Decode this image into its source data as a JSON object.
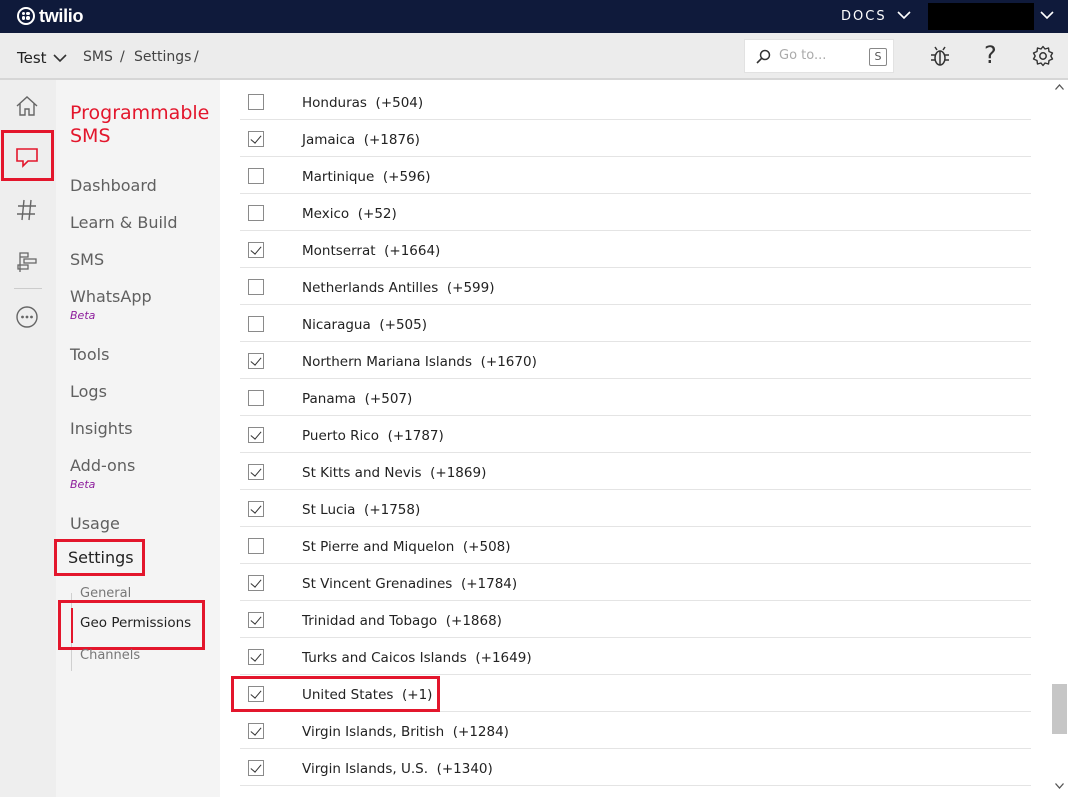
{
  "topbar": {
    "logo_text": "twilio",
    "docs_label": "DOCS"
  },
  "subbar": {
    "project": "Test",
    "breadcrumb": [
      "SMS",
      "/",
      "Settings",
      "/"
    ],
    "search_placeholder": "Go to...",
    "search_shortcut": "S",
    "help_label": "?"
  },
  "rail": {
    "icons": [
      "home-icon",
      "chat-icon",
      "hash-icon",
      "flow-icon",
      "more-icon"
    ]
  },
  "nav": {
    "title": "Programmable SMS",
    "items": [
      {
        "label": "Dashboard"
      },
      {
        "label": "Learn & Build"
      },
      {
        "label": "SMS"
      },
      {
        "label": "WhatsApp",
        "badge": "Beta"
      },
      {
        "label": "Tools"
      },
      {
        "label": "Logs"
      },
      {
        "label": "Insights"
      },
      {
        "label": "Add-ons",
        "badge": "Beta"
      },
      {
        "label": "Usage"
      }
    ],
    "settings_label": "Settings",
    "settings_sub": [
      "General",
      "Geo Permissions",
      "Channels"
    ]
  },
  "countries": [
    {
      "name": "Honduras",
      "code": "(+504)",
      "checked": false
    },
    {
      "name": "Jamaica",
      "code": "(+1876)",
      "checked": true
    },
    {
      "name": "Martinique",
      "code": "(+596)",
      "checked": false
    },
    {
      "name": "Mexico",
      "code": "(+52)",
      "checked": false
    },
    {
      "name": "Montserrat",
      "code": "(+1664)",
      "checked": true
    },
    {
      "name": "Netherlands Antilles",
      "code": "(+599)",
      "checked": false
    },
    {
      "name": "Nicaragua",
      "code": "(+505)",
      "checked": false
    },
    {
      "name": "Northern Mariana Islands",
      "code": "(+1670)",
      "checked": true
    },
    {
      "name": "Panama",
      "code": "(+507)",
      "checked": false
    },
    {
      "name": "Puerto Rico",
      "code": "(+1787)",
      "checked": true
    },
    {
      "name": "St Kitts and Nevis",
      "code": "(+1869)",
      "checked": true
    },
    {
      "name": "St Lucia",
      "code": "(+1758)",
      "checked": true
    },
    {
      "name": "St Pierre and Miquelon",
      "code": "(+508)",
      "checked": false
    },
    {
      "name": "St Vincent Grenadines",
      "code": "(+1784)",
      "checked": true
    },
    {
      "name": "Trinidad and Tobago",
      "code": "(+1868)",
      "checked": true
    },
    {
      "name": "Turks and Caicos Islands",
      "code": "(+1649)",
      "checked": true
    },
    {
      "name": "United States",
      "code": "(+1)",
      "checked": true
    },
    {
      "name": "Virgin Islands, British",
      "code": "(+1284)",
      "checked": true
    },
    {
      "name": "Virgin Islands, U.S.",
      "code": "(+1340)",
      "checked": true
    }
  ],
  "colors": {
    "topbar": "#0f1a3b",
    "accent_red": "#e3162c",
    "beta_purple": "#8d1d9c"
  }
}
